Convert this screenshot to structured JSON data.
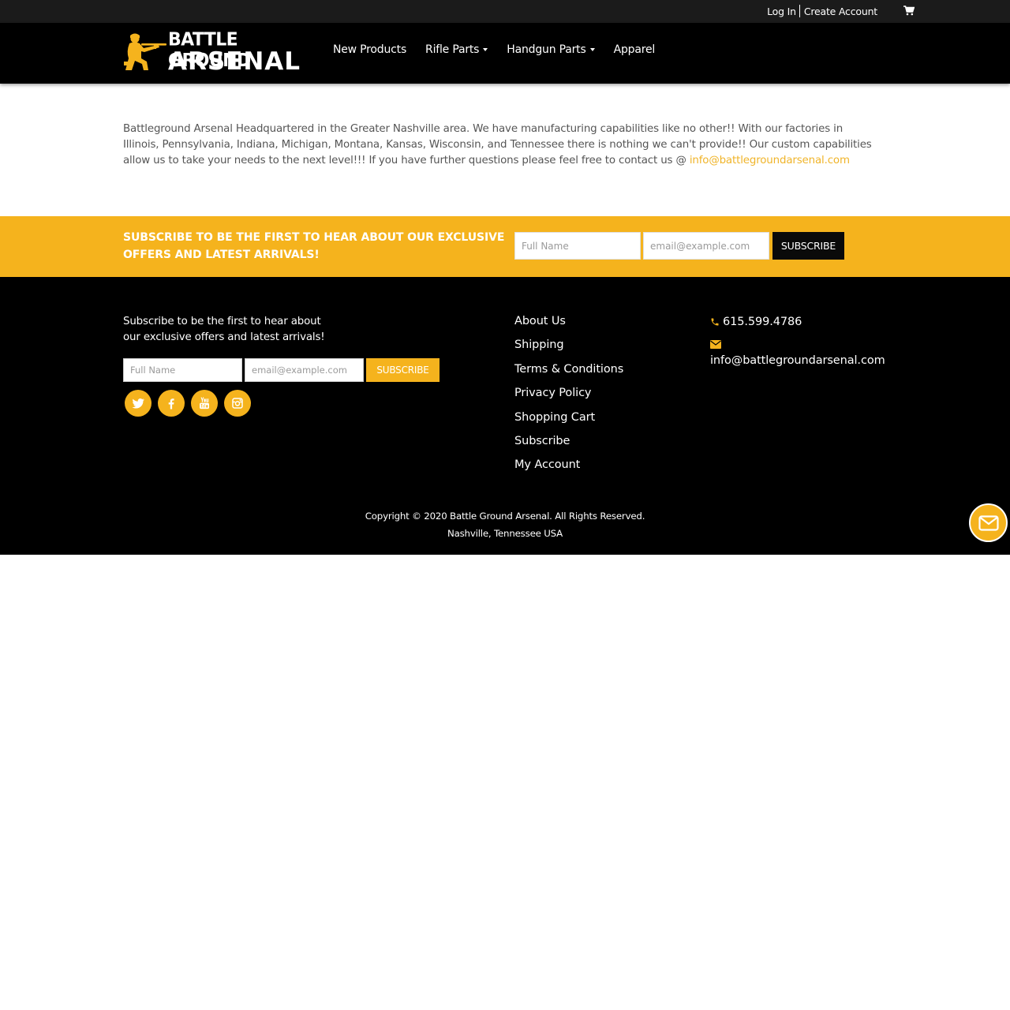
{
  "topbar": {
    "login_label": "Log In",
    "create_account_label": "Create Account",
    "cart_icon": "shopping-cart-icon"
  },
  "header": {
    "logo": {
      "line1": "BATTLE GROUND",
      "line2": "ARSENAL",
      "accent_color": "#f5b31d"
    },
    "nav": [
      {
        "label": "New Products",
        "has_dropdown": false
      },
      {
        "label": "Rifle Parts",
        "has_dropdown": true
      },
      {
        "label": "Handgun Parts",
        "has_dropdown": true
      },
      {
        "label": "Apparel",
        "has_dropdown": false
      }
    ]
  },
  "intro": {
    "text": "Battleground Arsenal Headquartered in the Greater Nashville area. We have manufacturing capabilities like no other!! With our factories in Illinois, Pennsylvania, Indiana, Michigan, Montana, Kansas, Wisconsin, and Tennessee there is nothing we can't provide!! Our custom capabilities allow us to take your needs to the next level!!! If you have further questions please feel free to contact us @ ",
    "email_link": "info@battlegroundarsenal.com"
  },
  "subscribe_band": {
    "headline": "SUBSCRIBE TO BE THE FIRST TO HEAR ABOUT OUR EXCLUSIVE OFFERS AND LATEST ARRIVALS!",
    "name_placeholder": "Full Name",
    "email_placeholder": "email@example.com",
    "button_label": "SUBSCRIBE",
    "background_color": "#f5b31d"
  },
  "footer": {
    "subscribe_text": "Subscribe to be the first to hear about our exclusive offers and latest arrivals!",
    "name_placeholder": "Full Name",
    "email_placeholder": "email@example.com",
    "button_label": "SUBSCRIBE",
    "social": [
      "twitter-icon",
      "facebook-icon",
      "youtube-icon",
      "instagram-icon"
    ],
    "links": [
      "About Us",
      "Shipping",
      "Terms & Conditions",
      "Privacy Policy",
      "Shopping Cart",
      "Subscribe",
      "My Account"
    ],
    "phone": "615.599.4786",
    "email": "info@battlegroundarsenal.com",
    "copyright_line1": "Copyright © 2020 Battle Ground Arsenal. All Rights Reserved.",
    "copyright_line2": "Nashville, Tennessee USA"
  },
  "chat_widget": {
    "icon": "envelope-icon"
  }
}
